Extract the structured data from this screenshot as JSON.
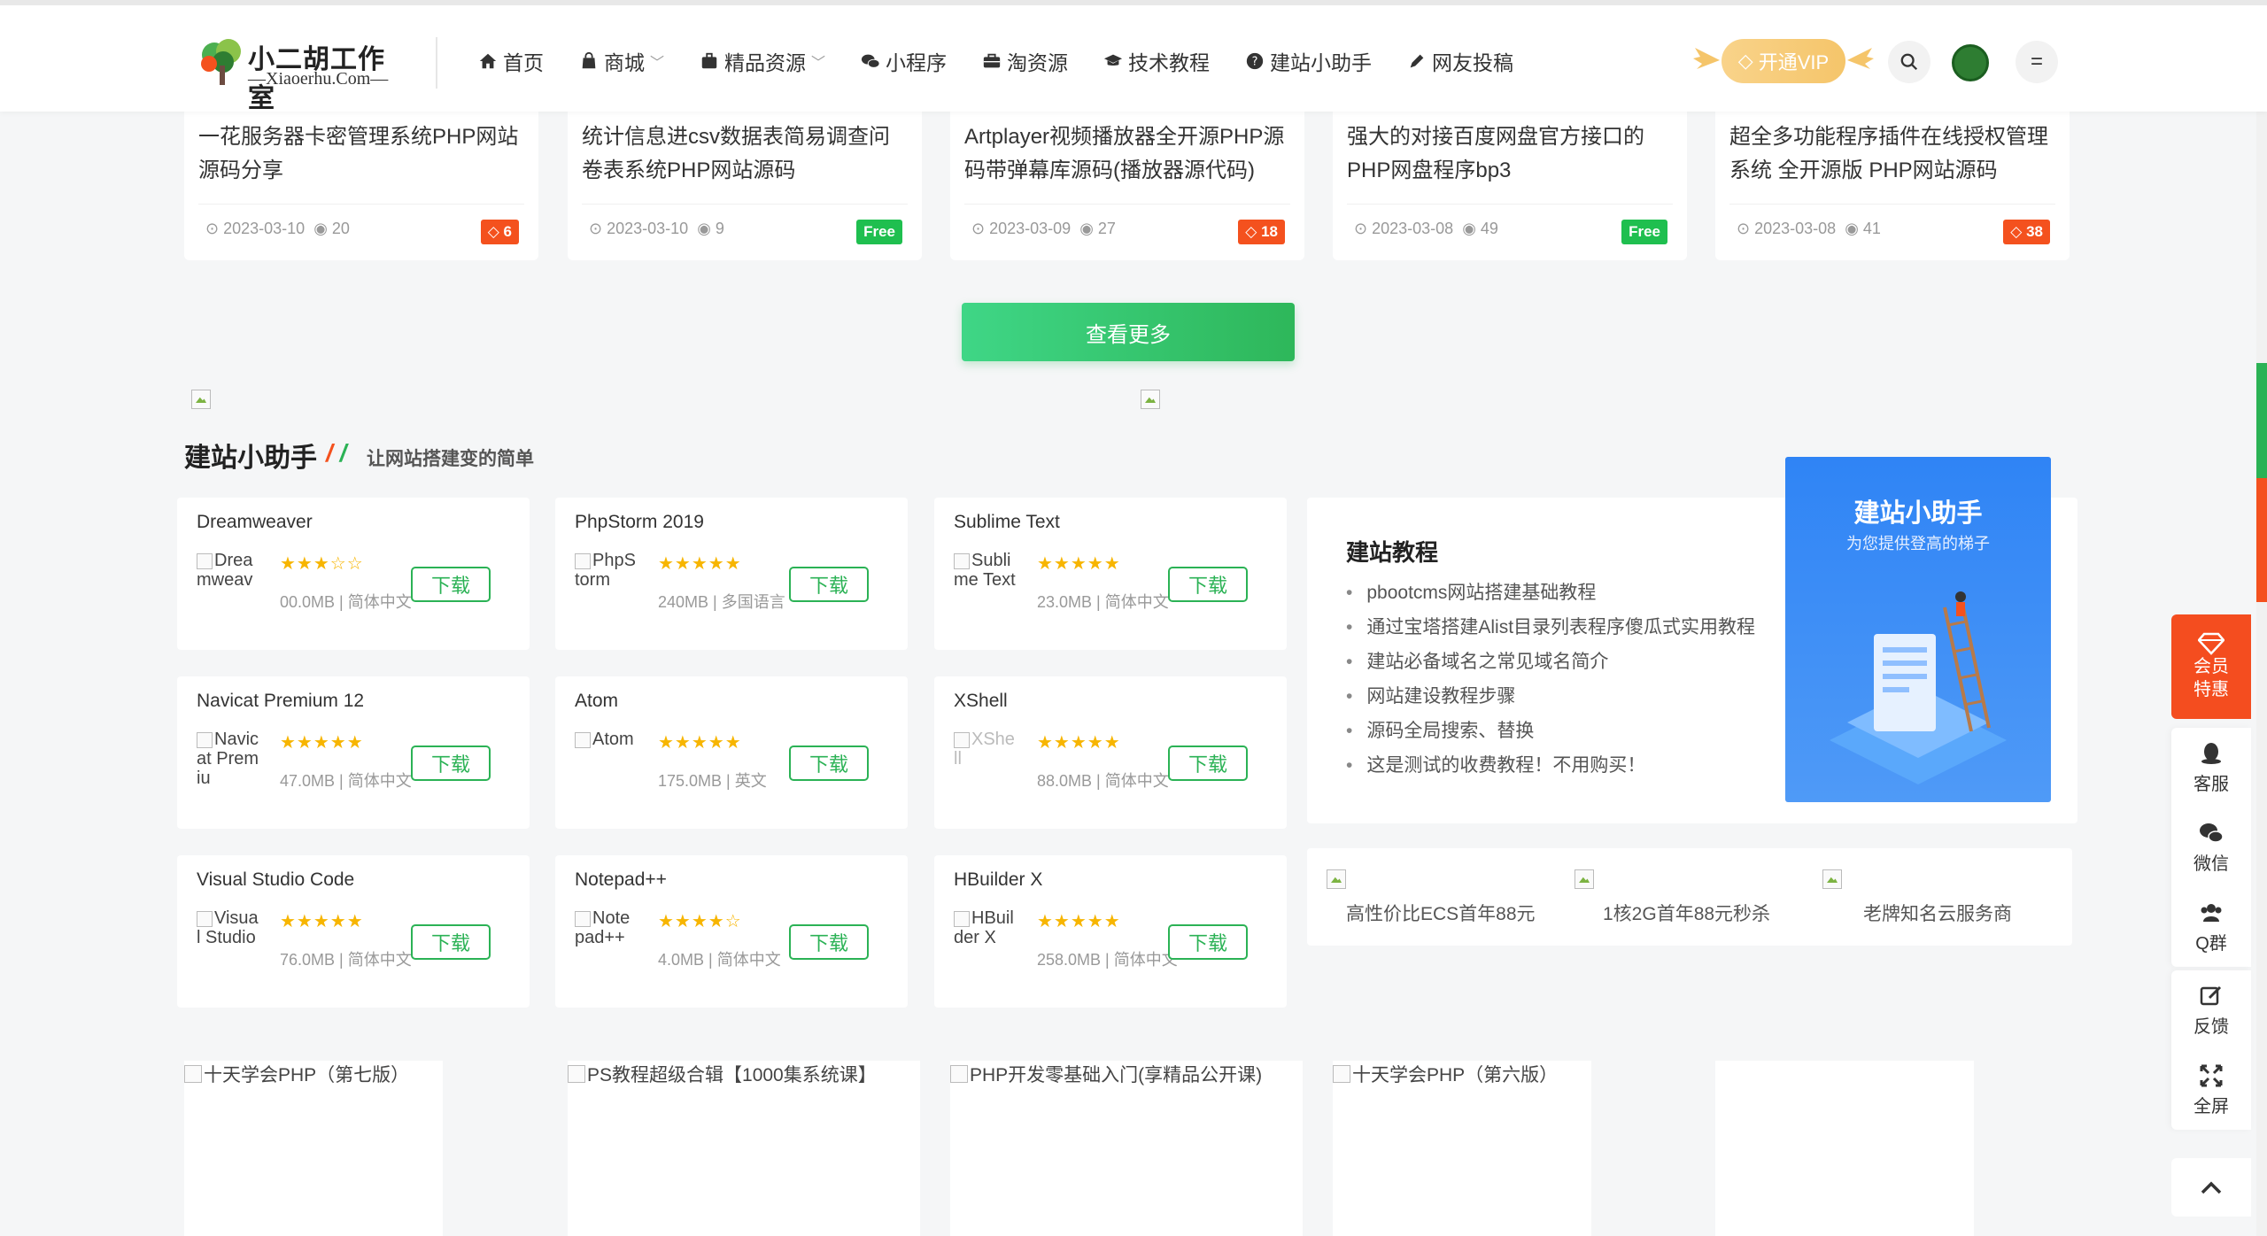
{
  "header": {
    "logo_title": "小二胡工作室",
    "logo_sub": "—Xiaoerhu.Com—",
    "nav": [
      {
        "label": "首页",
        "icon": "home-icon"
      },
      {
        "label": "商城",
        "icon": "shop-icon",
        "dropdown": true
      },
      {
        "label": "精品资源",
        "icon": "briefcase-icon",
        "dropdown": true
      },
      {
        "label": "小程序",
        "icon": "wechat-icon"
      },
      {
        "label": "淘资源",
        "icon": "suitcase-icon"
      },
      {
        "label": "技术教程",
        "icon": "graduation-cap-icon"
      },
      {
        "label": "建站小助手",
        "icon": "question-circle-icon"
      },
      {
        "label": "网友投稿",
        "icon": "pen-icon"
      }
    ],
    "vip_label": "开通VIP"
  },
  "top_cards": [
    {
      "title": "一花服务器卡密管理系统PHP网站源码分享",
      "date": "2023-03-10",
      "views": "20",
      "price": "6",
      "type": "paid"
    },
    {
      "title": "统计信息进csv数据表简易调查问卷表系统PHP网站源码",
      "date": "2023-03-10",
      "views": "9",
      "price": "Free",
      "type": "free"
    },
    {
      "title": "Artplayer视频播放器全开源PHP源码带弹幕库源码(播放器源代码)",
      "date": "2023-03-09",
      "views": "27",
      "price": "18",
      "type": "paid"
    },
    {
      "title": "强大的对接百度网盘官方接口的PHP网盘程序bp3",
      "date": "2023-03-08",
      "views": "49",
      "price": "Free",
      "type": "free"
    },
    {
      "title": "超全多功能程序插件在线授权管理系统 全开源版 PHP网站源码",
      "date": "2023-03-08",
      "views": "41",
      "price": "38",
      "type": "paid"
    }
  ],
  "more_button": "查看更多",
  "section": {
    "title": "建站小助手",
    "slash": "/ /",
    "subtitle": "让网站搭建变的简单"
  },
  "tools": [
    {
      "name": "Dreamweaver",
      "thumb": "Dreamweav",
      "stars": "★★★☆☆",
      "size": "00.0MB",
      "lang": "简体中文"
    },
    {
      "name": "PhpStorm 2019",
      "thumb": "PhpStorm",
      "stars": "★★★★★",
      "size": "240MB",
      "lang": "多国语言"
    },
    {
      "name": "Sublime Text",
      "thumb": "Sublime Text",
      "stars": "★★★★★",
      "size": "23.0MB",
      "lang": "简体中文"
    },
    {
      "name": "Navicat Premium 12",
      "thumb": "Navicat Premiu",
      "stars": "★★★★★",
      "size": "47.0MB",
      "lang": "简体中文"
    },
    {
      "name": "Atom",
      "thumb": "Atom",
      "stars": "★★★★★",
      "size": "175.0MB",
      "lang": "英文"
    },
    {
      "name": "XShell",
      "thumb": "XShell",
      "stars": "★★★★★",
      "size": "88.0MB",
      "lang": "简体中文"
    },
    {
      "name": "Visual Studio Code",
      "thumb": "Visual Studio",
      "stars": "★★★★★",
      "size": "76.0MB",
      "lang": "简体中文"
    },
    {
      "name": "Notepad++",
      "thumb": "Notepad++",
      "stars": "★★★★☆",
      "size": "4.0MB",
      "lang": "简体中文"
    },
    {
      "name": "HBuilder X",
      "thumb": "HBuilder X",
      "stars": "★★★★★",
      "size": "258.0MB",
      "lang": "简体中文"
    }
  ],
  "download_label": "下载",
  "tutorial": {
    "title": "建站教程",
    "items": [
      "pbootcms网站搭建基础教程",
      "通过宝塔搭建Alist目录列表程序傻瓜式实用教程",
      "建站必备域名之常见域名简介",
      "网站建设教程步骤",
      "源码全局搜索、替换",
      "这是测试的收费教程！不用购买！"
    ]
  },
  "banner": {
    "title": "建站小助手",
    "subtitle": "为您提供登高的梯子"
  },
  "ads": [
    "高性价比ECS首年88元",
    "1核2G首年88元秒杀",
    "老牌知名云服务商"
  ],
  "courses": [
    "十天学会PHP（第七版）",
    "PS教程超级合辑【1000集系统课】",
    "PHP开发零基础入门(享精品公开课)",
    "十天学会PHP（第六版）"
  ],
  "float_bar": {
    "vip": [
      "会员",
      "特惠"
    ],
    "items": [
      "客服",
      "微信",
      "Q群"
    ],
    "items2": [
      "反馈",
      "全屏"
    ]
  },
  "colors": {
    "accent_green": "#2bb255",
    "accent_orange": "#f4511e",
    "banner_blue": "#2f84f5",
    "vip_gold": "#f5c56a"
  }
}
